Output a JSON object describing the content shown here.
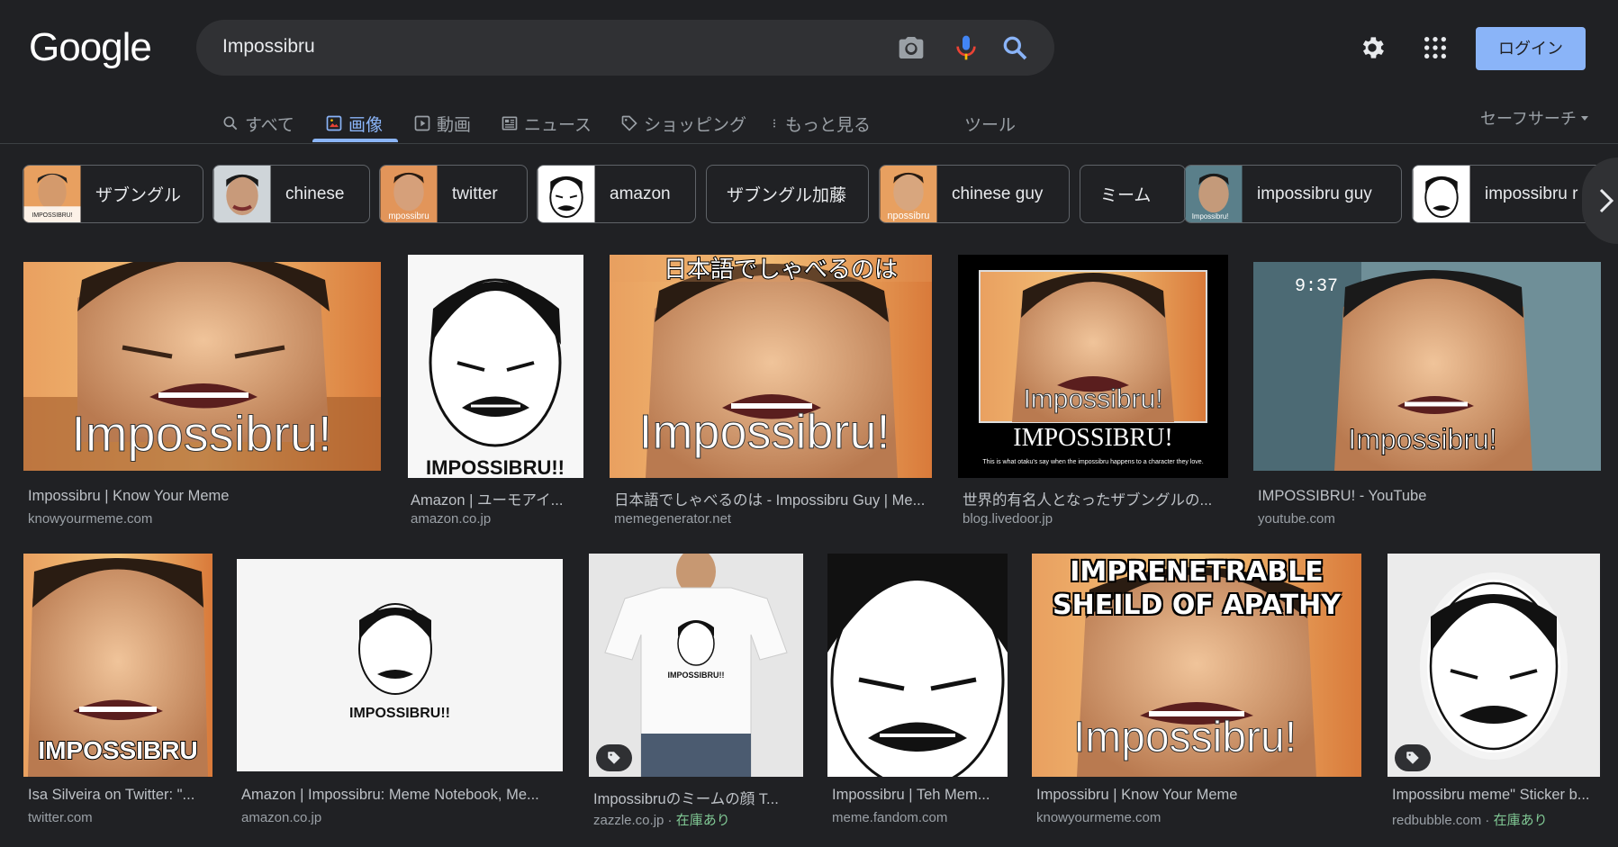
{
  "logo": "Google",
  "search": {
    "query": "Impossibru"
  },
  "header": {
    "login_label": "ログイン"
  },
  "tabs": [
    {
      "label": "すべて",
      "icon": "search-icon"
    },
    {
      "label": "画像",
      "icon": "image-icon",
      "active": true
    },
    {
      "label": "動画",
      "icon": "video-icon"
    },
    {
      "label": "ニュース",
      "icon": "news-icon"
    },
    {
      "label": "ショッピング",
      "icon": "tag-icon"
    },
    {
      "label": "もっと見る",
      "icon": "more-vert-icon"
    },
    {
      "label": "ツール"
    }
  ],
  "safesearch": {
    "label": "セーフサーチ"
  },
  "chips": [
    {
      "label": "ザブングル"
    },
    {
      "label": "chinese"
    },
    {
      "label": "twitter"
    },
    {
      "label": "amazon"
    },
    {
      "label": "ザブングル加藤"
    },
    {
      "label": "chinese guy"
    },
    {
      "label": "ミーム"
    },
    {
      "label": "impossibru guy"
    },
    {
      "label": "impossibru r"
    }
  ],
  "results": [
    {
      "title": "Impossibru | Know Your Meme",
      "source": "knowyourmeme.com",
      "caption": "Impossibru!"
    },
    {
      "title": "Amazon | ユーモアイ...",
      "source": "amazon.co.jp",
      "caption": "IMPOSSIBRU!!"
    },
    {
      "title": "日本語でしゃべるのは - Impossibru Guy | Me...",
      "source": "memegenerator.net",
      "caption": "Impossibru!",
      "top_caption": "日本語でしゃべるのは"
    },
    {
      "title": "世界的有名人となったザブングルの...",
      "source": "blog.livedoor.jp",
      "caption": "IMPOSSIBRU!",
      "inner_caption": "Impossibru!",
      "small_caption": "This is what otaku's say when the impossibru happens to a character they love."
    },
    {
      "title": "IMPOSSIBRU! - YouTube",
      "source": "youtube.com",
      "caption": "Impossibru!",
      "time": "9:37"
    },
    {
      "title": "Isa Silveira on Twitter: \"...",
      "source": "twitter.com",
      "caption": "IMPOSSIBRU"
    },
    {
      "title": "Amazon | Impossibru: Meme Notebook, Me...",
      "source": "amazon.co.jp",
      "caption": "IMPOSSIBRU!!"
    },
    {
      "title": "Impossibruのミームの顔 T...",
      "source": "zazzle.co.jp",
      "stock": "在庫あり",
      "caption": "IMPOSSIBRU!!"
    },
    {
      "title": "Impossibru | Teh Mem...",
      "source": "meme.fandom.com"
    },
    {
      "title": "Impossibru | Know Your Meme",
      "source": "knowyourmeme.com",
      "caption": "Impossibru!",
      "top_caption": "IMPRENETRABLE SHEILD OF APATHY"
    },
    {
      "title": "Impossibru meme\" Sticker b...",
      "source": "redbubble.com",
      "stock": "在庫あり"
    }
  ],
  "source_separator": " · "
}
